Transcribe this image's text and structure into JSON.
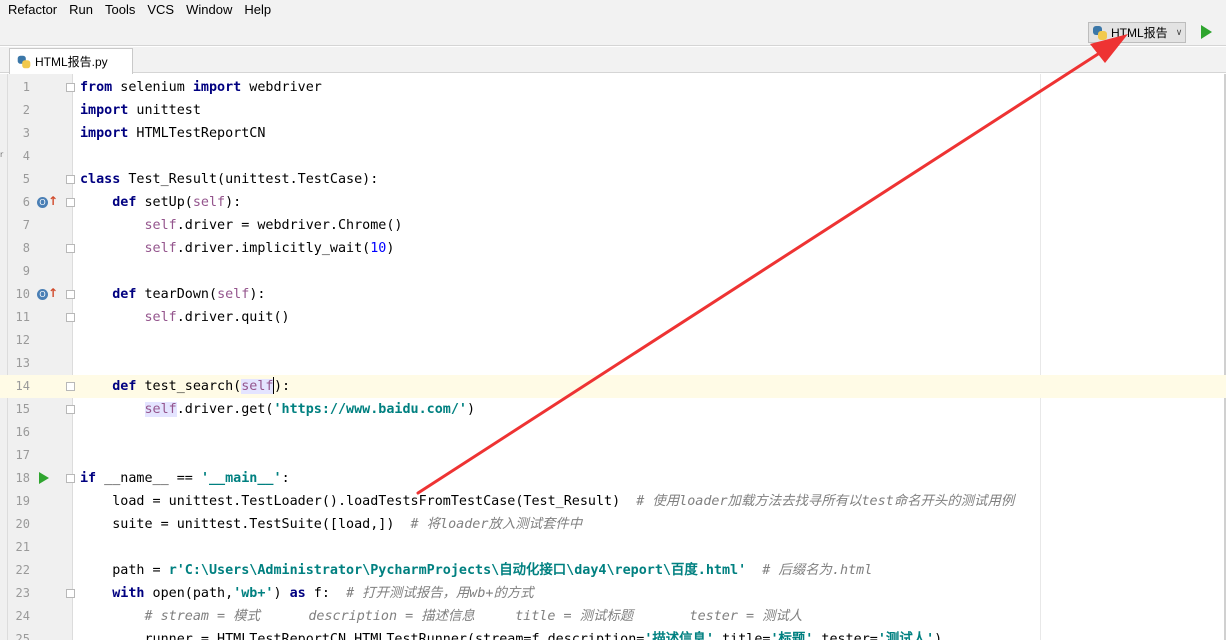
{
  "menu": [
    "Refactor",
    "Run",
    "Tools",
    "VCS",
    "Window",
    "Help"
  ],
  "toolbar": {
    "run_config_label": "HTML报告",
    "run_config_icon": "python-icon",
    "run_button_icon": "run-icon"
  },
  "tab": {
    "label": "HTML报告.py",
    "icon": "python-file-icon"
  },
  "side_fragments": [
    "r",
    "燃"
  ],
  "editor": {
    "current_line": 14,
    "lines": [
      {
        "n": "1"
      },
      {
        "n": "2"
      },
      {
        "n": "3"
      },
      {
        "n": "4"
      },
      {
        "n": "5"
      },
      {
        "n": "6"
      },
      {
        "n": "7"
      },
      {
        "n": "8"
      },
      {
        "n": "9"
      },
      {
        "n": "10"
      },
      {
        "n": "11"
      },
      {
        "n": "12"
      },
      {
        "n": "13"
      },
      {
        "n": "14"
      },
      {
        "n": "15"
      },
      {
        "n": "16"
      },
      {
        "n": "17"
      },
      {
        "n": "18"
      },
      {
        "n": "19"
      },
      {
        "n": "20"
      },
      {
        "n": "21"
      },
      {
        "n": "22"
      },
      {
        "n": "23"
      },
      {
        "n": "24"
      },
      {
        "n": "25"
      }
    ],
    "code": {
      "l1": [
        "from",
        " selenium ",
        "import",
        " webdriver"
      ],
      "l2": [
        "import",
        " unittest"
      ],
      "l3": [
        "import",
        " HTMLTestReportCN"
      ],
      "l5": [
        "class",
        " Test_Result(unittest.TestCase):"
      ],
      "l6": [
        "    ",
        "def",
        " setUp(",
        "self",
        "):"
      ],
      "l7": [
        "        ",
        "self",
        ".driver = webdriver.Chrome()"
      ],
      "l8": [
        "        ",
        "self",
        ".driver.implicitly_wait(",
        "10",
        ")"
      ],
      "l10": [
        "    ",
        "def",
        " tearDown(",
        "self",
        "):"
      ],
      "l11": [
        "        ",
        "self",
        ".driver.quit()"
      ],
      "l14": [
        "    ",
        "def",
        " test_search(",
        "self",
        "):"
      ],
      "l15": [
        "        ",
        "self",
        ".driver.get(",
        "'https://www.baidu.com/'",
        ")"
      ],
      "l18": [
        "if",
        " __name__ == ",
        "'__main__'",
        ":"
      ],
      "l19": [
        "    load = unittest.TestLoader().loadTestsFromTestCase(Test_Result)  ",
        "# 使用loader加载方法去找寻所有以test命名开头的测试用例"
      ],
      "l20": [
        "    suite = unittest.TestSuite([load,])  ",
        "# 将loader放入测试套件中"
      ],
      "l22": [
        "    path = ",
        "r'C:\\Users\\Administrator\\PycharmProjects\\自动化接口\\day4\\report\\百度.html'",
        "  ",
        "# 后缀名为.html"
      ],
      "l23": [
        "    ",
        "with",
        " open(path,",
        "'wb+'",
        ") ",
        "as",
        " f:  ",
        "# 打开测试报告，用wb+的方式"
      ],
      "l24": [
        "        ",
        "# stream = 模式      description = 描述信息     title = 测试标题       tester = 测试人"
      ],
      "l25": [
        "        runner = HTMLTestReportCN.HTMLTestRunner(stream=f,description=",
        "'描述信息'",
        ",title=",
        "'标题'",
        ",tester=",
        "'测试人'",
        ")"
      ]
    }
  },
  "annotation": {
    "color": "#ee3333"
  }
}
